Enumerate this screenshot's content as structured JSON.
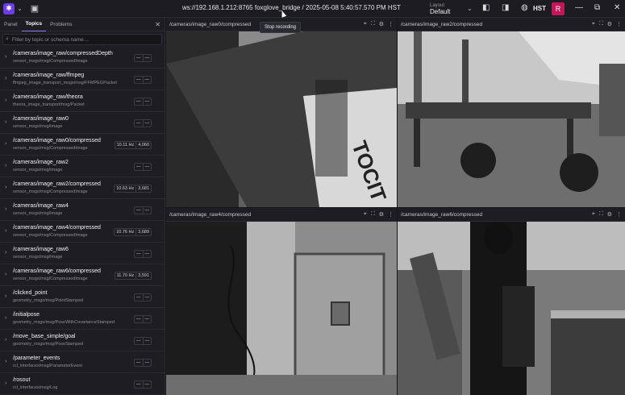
{
  "topbar": {
    "logo_icon": "foxglove-logo",
    "connection": "ws://192.168.1.212:8765 foxglove_bridge / 2025-05-08 5:40:57.570 PM HST",
    "layout_label": "Layout",
    "layout_value": "Default",
    "timezone": "HST",
    "avatar_letter": "R",
    "tooltip": "Stop recording"
  },
  "sidebar": {
    "tabs": [
      "Panel",
      "Topics",
      "Problems"
    ],
    "active_tab": "Topics",
    "search_placeholder": "Filter by topic or schema name…",
    "topics": [
      {
        "name": "/cameras/image_raw/compressedDepth",
        "type": "sensor_msgs/msg/CompressedImage",
        "hz": "—",
        "count": "—"
      },
      {
        "name": "/cameras/image_raw/ffmpeg",
        "type": "ffmpeg_image_transport_msgs/msg/FFMPEGPacket",
        "hz": "—",
        "count": "—"
      },
      {
        "name": "/cameras/image_raw/theora",
        "type": "theora_image_transport/msg/Packet",
        "hz": "—",
        "count": "—"
      },
      {
        "name": "/cameras/image_raw0",
        "type": "sensor_msgs/msg/Image",
        "hz": "—",
        "count": "—"
      },
      {
        "name": "/cameras/image_raw0/compressed",
        "type": "sensor_msgs/msg/CompressedImage",
        "hz": "10.11 Hz",
        "count": "4,060"
      },
      {
        "name": "/cameras/image_raw2",
        "type": "sensor_msgs/msg/Image",
        "hz": "—",
        "count": "—"
      },
      {
        "name": "/cameras/image_raw2/compressed",
        "type": "sensor_msgs/msg/CompressedImage",
        "hz": "10.63 Hz",
        "count": "3,681"
      },
      {
        "name": "/cameras/image_raw4",
        "type": "sensor_msgs/msg/Image",
        "hz": "—",
        "count": "—"
      },
      {
        "name": "/cameras/image_raw4/compressed",
        "type": "sensor_msgs/msg/CompressedImage",
        "hz": "10.76 Hz",
        "count": "3,689"
      },
      {
        "name": "/cameras/image_raw6",
        "type": "sensor_msgs/msg/Image",
        "hz": "—",
        "count": "—"
      },
      {
        "name": "/cameras/image_raw6/compressed",
        "type": "sensor_msgs/msg/CompressedImage",
        "hz": "11.70 Hz",
        "count": "3,591"
      },
      {
        "name": "/clicked_point",
        "type": "geometry_msgs/msg/PointStamped",
        "hz": "—",
        "count": "—"
      },
      {
        "name": "/initialpose",
        "type": "geometry_msgs/msg/PoseWithCovarianceStamped",
        "hz": "—",
        "count": "—"
      },
      {
        "name": "/move_base_simple/goal",
        "type": "geometry_msgs/msg/PoseStamped",
        "hz": "—",
        "count": "—"
      },
      {
        "name": "/parameter_events",
        "type": "rcl_interfaces/msg/ParameterEvent",
        "hz": "—",
        "count": "—"
      },
      {
        "name": "/rosout",
        "type": "rcl_interfaces/msg/Log",
        "hz": "—",
        "count": "—"
      }
    ]
  },
  "panels": [
    {
      "title": "/cameras/image_raw0/compressed",
      "scene": "bag"
    },
    {
      "title": "/cameras/image_raw2/compressed",
      "scene": "cart"
    },
    {
      "title": "/cameras/image_raw4/compressed",
      "scene": "door"
    },
    {
      "title": "/cameras/image_raw6/compressed",
      "scene": "lab"
    }
  ]
}
